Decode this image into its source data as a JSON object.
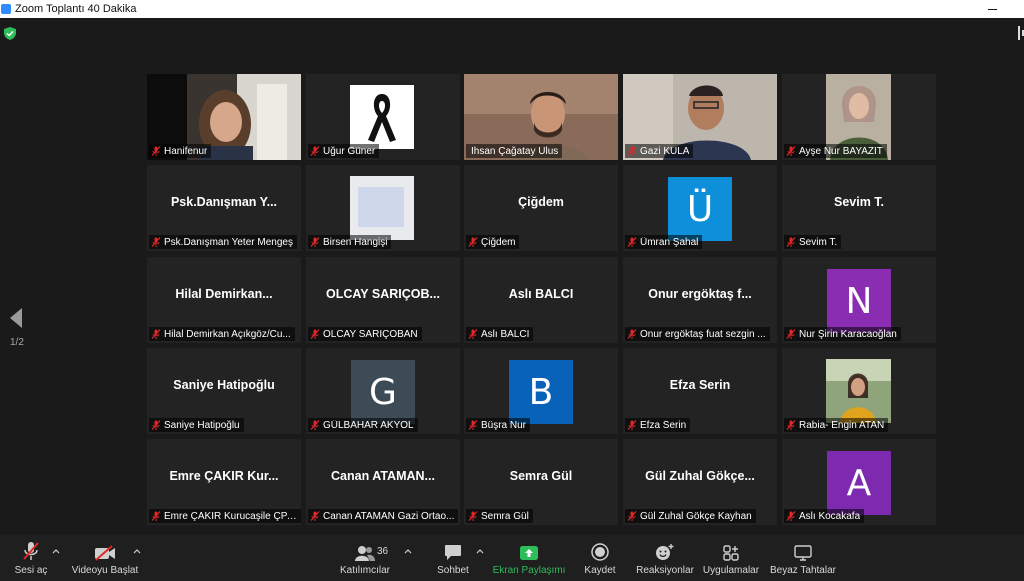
{
  "window": {
    "title": "Zoom Toplantı 40 Dakika"
  },
  "gallery": {
    "page_indicator": "1/2"
  },
  "participants": [
    {
      "name": "Hanifenur",
      "display": ""
    },
    {
      "name": "Uğur Güner",
      "display": ""
    },
    {
      "name": "İhsan Çağatay Ulus",
      "display": ""
    },
    {
      "name": "Gazi KULA",
      "display": ""
    },
    {
      "name": "Ayşe Nur BAYAZIT",
      "display": ""
    },
    {
      "name": "Psk.Danışman Yeter Mengeş",
      "display": "Psk.Danışman Y..."
    },
    {
      "name": "Birsen Hangişi",
      "display": ""
    },
    {
      "name": "Çiğdem",
      "display": "Çiğdem"
    },
    {
      "name": "Ümran Şahal",
      "display": "",
      "avatar": "Ü"
    },
    {
      "name": "Sevim T.",
      "display": "Sevim T."
    },
    {
      "name": "Hilal Demirkan Açıkgöz/Cu...",
      "display": "Hilal  Demirkan..."
    },
    {
      "name": "OLCAY SARIÇOBAN",
      "display": "OLCAY  SARIÇOB..."
    },
    {
      "name": "Aslı BALCI",
      "display": "Aslı BALCI"
    },
    {
      "name": "Onur ergöktaş fuat sezgin ...",
      "display": "Onur  ergöktaş  f..."
    },
    {
      "name": "Nur Şirin Karacaoğlan",
      "display": "",
      "avatar": "N"
    },
    {
      "name": "Saniye Hatipoğlu",
      "display": "Saniye Hatipoğlu"
    },
    {
      "name": "GÜLBAHAR AKYOL",
      "display": "",
      "avatar": "G"
    },
    {
      "name": "Büşra Nur",
      "display": "",
      "avatar": "B"
    },
    {
      "name": "Efza Serin",
      "display": "Efza Serin"
    },
    {
      "name": "Rabia- Engin ATAN",
      "display": ""
    },
    {
      "name": "Emre ÇAKIR Kurucaşile ÇPAL",
      "display": "Emre  ÇAKIR Kur..."
    },
    {
      "name": "Canan ATAMAN Gazi Ortao...",
      "display": "Canan  ATAMAN..."
    },
    {
      "name": "Semra Gül",
      "display": "Semra Gül"
    },
    {
      "name": "Gül Zuhal Gökçe Kayhan",
      "display": "Gül  Zuhal  Gökçe..."
    },
    {
      "name": "Aslı Kocakafa",
      "display": "",
      "avatar": "A"
    }
  ],
  "avatar_colors": {
    "Ü": "#0e8fd9",
    "N": "#8a2db3",
    "G": "#3d4b56",
    "B": "#0862b8",
    "A": "#7e2ab0"
  },
  "toolbar": {
    "audio": "Sesi aç",
    "video": "Videoyu Başlat",
    "participants": "Katılımcılar",
    "participants_count": "36",
    "chat": "Sohbet",
    "share": "Ekran Paylaşımı",
    "record": "Kaydet",
    "reactions": "Reaksiyonlar",
    "apps": "Uygulamalar",
    "whiteboard": "Beyaz Tahtalar"
  },
  "colors": {
    "active_speaker": "#c8d96a",
    "share_green": "#2ebd59",
    "muted_red": "#e02828"
  }
}
